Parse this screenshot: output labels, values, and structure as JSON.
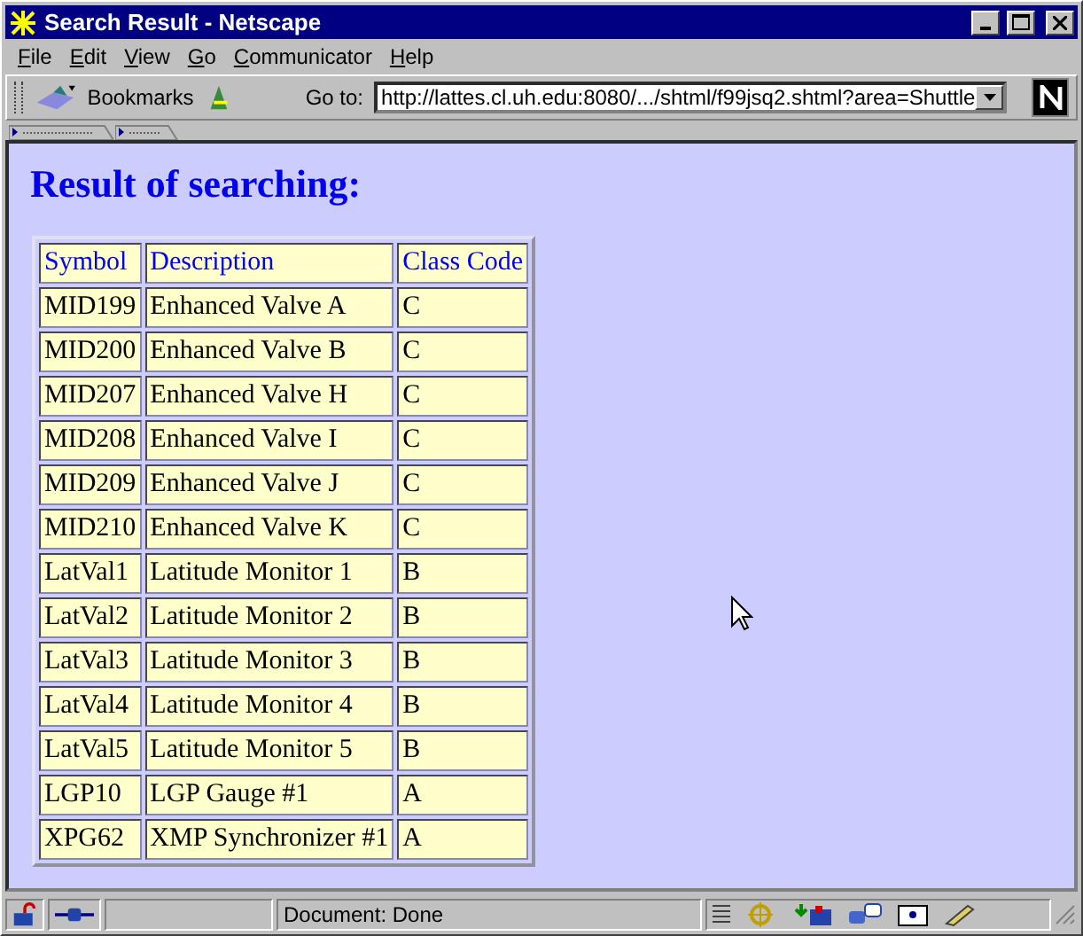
{
  "window": {
    "title": "Search Result - Netscape"
  },
  "menu": [
    "File",
    "Edit",
    "View",
    "Go",
    "Communicator",
    "Help"
  ],
  "toolbar": {
    "bookmarks": "Bookmarks",
    "goto_label": "Go to:",
    "url": "http://lattes.cl.uh.edu:8080/.../shtml/f99jsq2.shtml?area=Shuttle"
  },
  "page": {
    "heading": "Result of searching:",
    "table": {
      "columns": [
        "Symbol",
        "Description",
        "Class Code"
      ],
      "rows": [
        [
          "MID199",
          "Enhanced Valve A",
          "C"
        ],
        [
          "MID200",
          "Enhanced Valve B",
          "C"
        ],
        [
          "MID207",
          "Enhanced Valve H",
          "C"
        ],
        [
          "MID208",
          "Enhanced Valve I",
          "C"
        ],
        [
          "MID209",
          "Enhanced Valve J",
          "C"
        ],
        [
          "MID210",
          "Enhanced Valve K",
          "C"
        ],
        [
          "LatVal1",
          "Latitude Monitor 1",
          "B"
        ],
        [
          "LatVal2",
          "Latitude Monitor 2",
          "B"
        ],
        [
          "LatVal3",
          "Latitude Monitor 3",
          "B"
        ],
        [
          "LatVal4",
          "Latitude Monitor 4",
          "B"
        ],
        [
          "LatVal5",
          "Latitude Monitor 5",
          "B"
        ],
        [
          "LGP10",
          "LGP Gauge #1",
          "A"
        ],
        [
          "XPG62",
          "XMP Synchronizer #1",
          "A"
        ]
      ]
    }
  },
  "status_bar": {
    "text": "Document: Done"
  }
}
